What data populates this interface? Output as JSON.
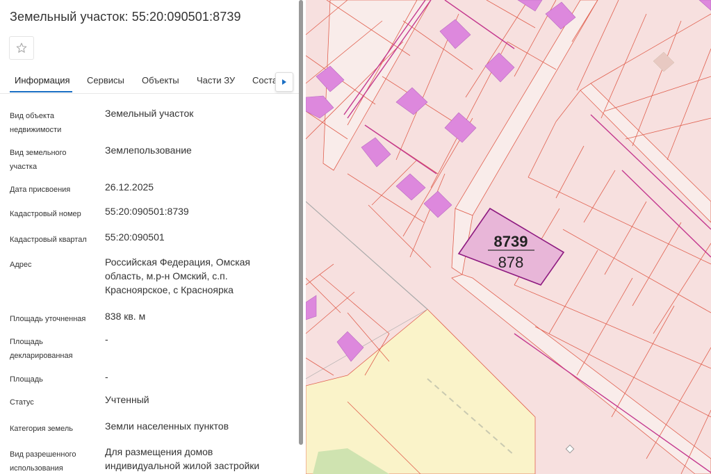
{
  "panel": {
    "title": "Земельный участок: 55:20:090501:8739",
    "favorite_icon": "star-icon",
    "tabs": [
      {
        "label": "Информация",
        "active": true
      },
      {
        "label": "Сервисы",
        "active": false
      },
      {
        "label": "Объекты",
        "active": false
      },
      {
        "label": "Части ЗУ",
        "active": false
      },
      {
        "label": "Соста",
        "active": false
      }
    ],
    "tabs_next_icon": "triangle-right-icon",
    "fields": [
      {
        "label": "Вид объекта недвижимости",
        "value": "Земельный участок"
      },
      {
        "label": "Вид земельного участка",
        "value": "Землепользование"
      },
      {
        "label": "Дата присвоения",
        "value": "26.12.2025"
      },
      {
        "label": "Кадастровый номер",
        "value": "55:20:090501:8739"
      },
      {
        "label": "Кадастровый квартал",
        "value": "55:20:090501"
      },
      {
        "label": "Адрес",
        "value": "Российская Федерация, Омская область, м.р-н Омский, с.п. Красноярское, с Красноярка"
      },
      {
        "label": "Площадь уточненная",
        "value": "838 кв. м"
      },
      {
        "label": "Площадь декларированная",
        "value": "-"
      },
      {
        "label": "Площадь",
        "value": "-"
      },
      {
        "label": "Статус",
        "value": "Учтенный"
      },
      {
        "label": "Категория земель",
        "value": "Земли населенных пунктов"
      },
      {
        "label": "Вид разрешенного использования",
        "value": "Для размещения домов индивидуальной жилой застройки"
      }
    ]
  },
  "map": {
    "selected_parcel": {
      "number": "8739",
      "sub_number": "878"
    },
    "colors": {
      "parcel_fill": "#f7e0df",
      "parcel_line": "#e0604f",
      "building": "#dd88dd",
      "selected_fill": "#e8b6d8",
      "selected_line": "#8e1a80",
      "yellow_zone": "#faf3c9",
      "green_zone": "#cfe3b0"
    }
  }
}
